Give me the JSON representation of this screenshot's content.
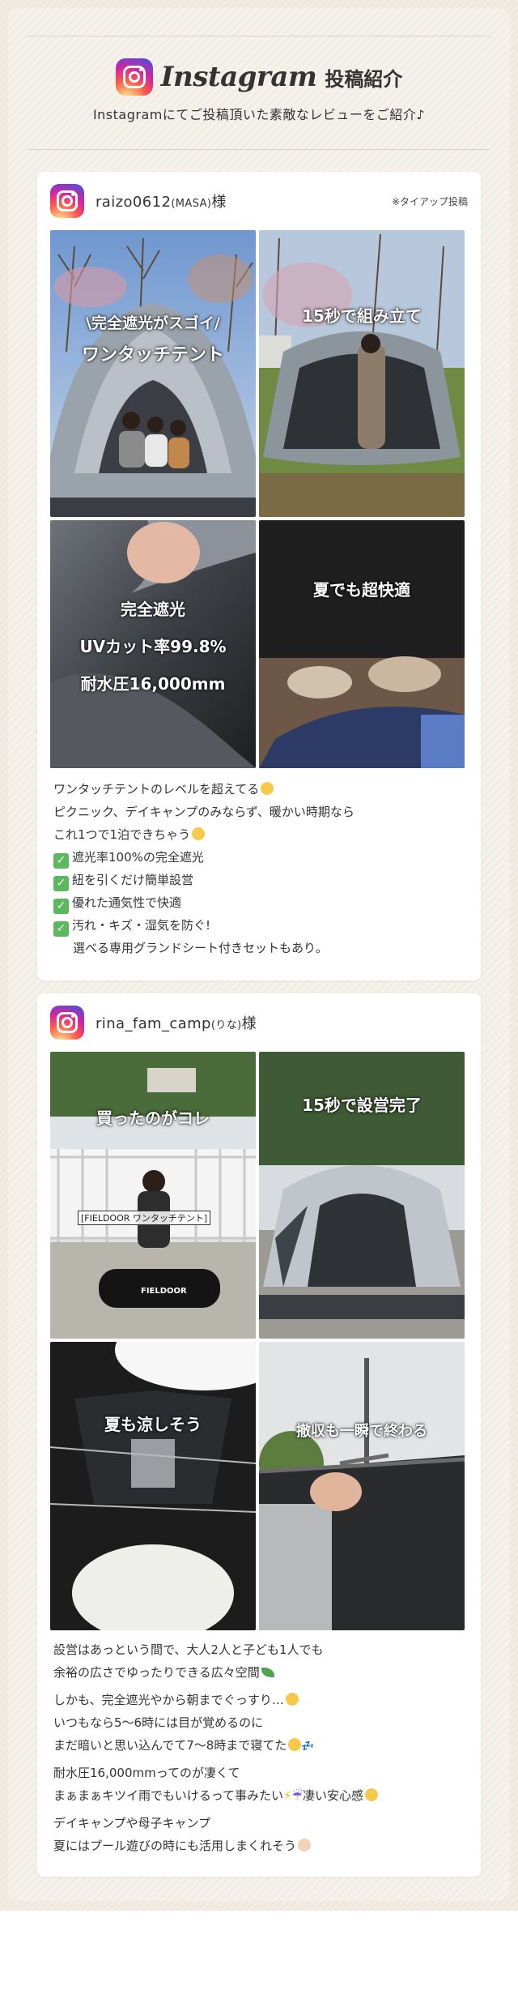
{
  "header": {
    "title_script": "Instagram",
    "title_jp": "投稿紹介",
    "subtitle": "Instagramにてご投稿頂いた素敵なレビューをご紹介♪"
  },
  "posts": [
    {
      "username": "raizo0612",
      "nickname": "(MASA)",
      "honorific": "様",
      "tieup": "※タイアップ投稿",
      "photos": [
        {
          "captions": [
            "\\完全遮光がスゴイ/",
            "ワンタッチテント"
          ]
        },
        {
          "captions": [
            "15秒で組み立て"
          ]
        },
        {
          "captions": [
            "完全遮光",
            "UVカット率99.8%",
            "耐水圧16,000mm"
          ]
        },
        {
          "captions": [
            "夏でも超快適"
          ]
        }
      ],
      "review": [
        "ワンタッチテントのレベルを超えてる",
        "ピクニック、デイキャンプのみならず、暖かい時期なら",
        "これ1つで1泊できちゃう",
        "遮光率100%の完全遮光",
        "紐を引くだけ簡単設営",
        "優れた通気性で快適",
        "汚れ・キズ・湿気を防ぐ!",
        "選べる専用グランドシート付きセットもあり。"
      ]
    },
    {
      "username": "rina_fam_camp",
      "nickname": "(りな)",
      "honorific": "様",
      "photos": [
        {
          "captions": [
            "買ったのがコレ"
          ],
          "label": "[FIELDOOR ワンタッチテント]",
          "bag_label": "FIELDOOR"
        },
        {
          "captions": [
            "15秒で設営完了"
          ]
        },
        {
          "captions": [
            "夏も涼しそう"
          ]
        },
        {
          "captions": [
            "撤収も一瞬で終わる"
          ]
        }
      ],
      "review": [
        "設営はあっという間で、大人2人と子ども1人でも",
        "余裕の広さでゆったりできる広々空間",
        "しかも、完全遮光やから朝までぐっすり…",
        "いつもなら5〜6時には目が覚めるのに",
        "まだ暗いと思い込んでて7〜8時まで寝てた",
        "耐水圧16,000mmってのが凄くて",
        "まぁまぁキツイ雨でもいけるって事みたい",
        "凄い安心感",
        "デイキャンプや母子キャンプ",
        "夏にはプール遊びの時にも活用しまくれそう"
      ]
    }
  ],
  "icons": {
    "instagram": "instagram-logo-icon",
    "check": "check-box-icon"
  },
  "colors": {
    "background": "#eee9df",
    "card": "#ffffff",
    "check_green": "#5bb85d",
    "instagram_gradient": [
      "#fdf497",
      "#fd5949",
      "#d6249f",
      "#285AEB"
    ]
  }
}
